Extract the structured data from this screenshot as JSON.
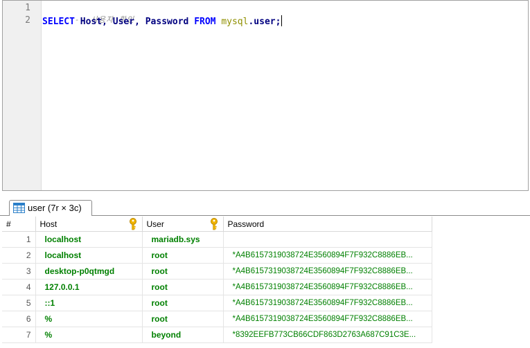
{
  "editor": {
    "line_numbers": [
      "1",
      "2"
    ],
    "line1_comment": "-- 사용자 확인",
    "line2": {
      "select": "SELECT",
      "col1": "Host",
      "comma1": ",",
      "col2": "User",
      "comma2": ",",
      "col3": "Password",
      "from": "FROM",
      "schema": "mysql",
      "dot": ".",
      "table": "user",
      "semicolon": ";"
    }
  },
  "result_tab": {
    "label": "user (7r × 3c)",
    "icon": "table-grid-icon"
  },
  "grid": {
    "columns": [
      "#",
      "Host",
      "User",
      "Password"
    ],
    "key_columns": [
      "Host",
      "User"
    ],
    "rows": [
      {
        "n": "1",
        "host": "localhost",
        "user": "mariadb.sys",
        "password": ""
      },
      {
        "n": "2",
        "host": "localhost",
        "user": "root",
        "password": "*A4B6157319038724E3560894F7F932C8886EB..."
      },
      {
        "n": "3",
        "host": "desktop-p0qtmgd",
        "user": "root",
        "password": "*A4B6157319038724E3560894F7F932C8886EB..."
      },
      {
        "n": "4",
        "host": "127.0.0.1",
        "user": "root",
        "password": "*A4B6157319038724E3560894F7F932C8886EB..."
      },
      {
        "n": "5",
        "host": "::1",
        "user": "root",
        "password": "*A4B6157319038724E3560894F7F932C8886EB..."
      },
      {
        "n": "6",
        "host": "%",
        "user": "root",
        "password": "*A4B6157319038724E3560894F7F932C8886EB..."
      },
      {
        "n": "7",
        "host": "%",
        "user": "beyond",
        "password": "*8392EEFB773CB66CDF863D2763A687C91C3E..."
      }
    ]
  },
  "colors": {
    "keyword": "#0000ff",
    "identifier": "#000080",
    "schema": "#8f8f00",
    "comment": "#909090",
    "cell_text": "#008000",
    "key_icon": "#f0b400"
  }
}
